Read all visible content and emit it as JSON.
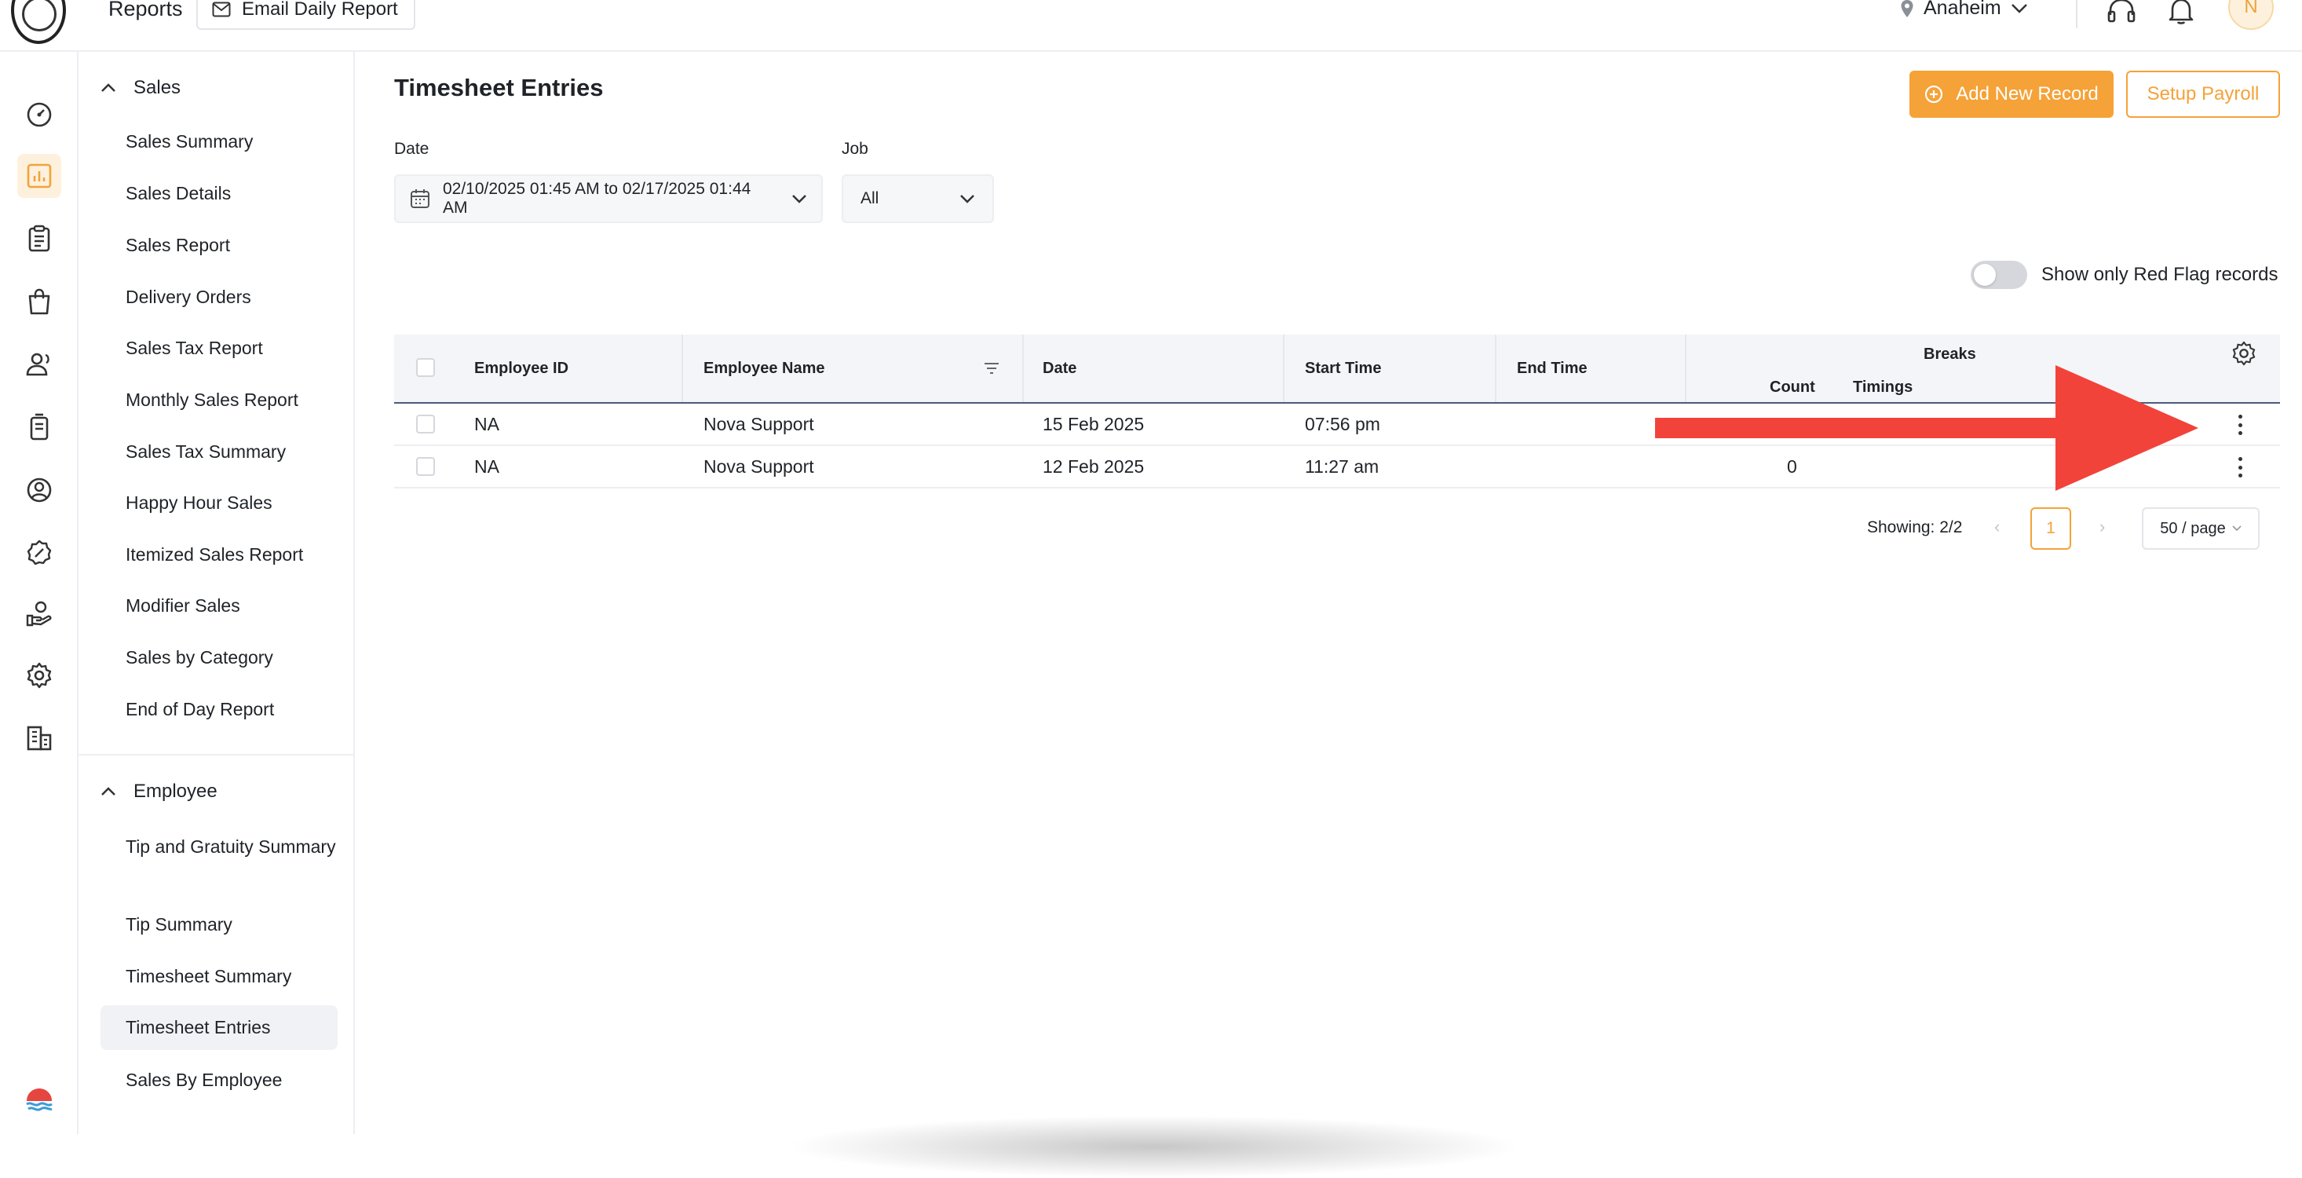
{
  "header": {
    "title": "Reports",
    "email_button": "Email Daily Report",
    "location": "Anaheim",
    "avatar_initial": "N"
  },
  "sidebar": {
    "sales_section": "Sales",
    "sales_items": [
      "Sales Summary",
      "Sales Details",
      "Sales Report",
      "Delivery Orders",
      "Sales Tax Report",
      "Monthly Sales Report",
      "Sales Tax Summary",
      "Happy Hour Sales",
      "Itemized Sales Report",
      "Modifier Sales",
      "Sales by Category",
      "End of Day Report"
    ],
    "employee_section": "Employee",
    "employee_items": [
      "Tip and Gratuity Summary",
      "Tip Summary",
      "Timesheet Summary",
      "Timesheet Entries",
      "Sales By Employee"
    ]
  },
  "main": {
    "title": "Timesheet Entries",
    "add_button": "Add New Record",
    "setup_button": "Setup Payroll",
    "date_label": "Date",
    "date_value": "02/10/2025 01:45 AM to 02/17/2025 01:44 AM",
    "job_label": "Job",
    "job_value": "All",
    "toggle_label": "Show only Red Flag records",
    "table": {
      "columns": {
        "employee_id": "Employee ID",
        "employee_name": "Employee Name",
        "date": "Date",
        "start_time": "Start Time",
        "end_time": "End Time",
        "breaks": "Breaks",
        "count": "Count",
        "timings": "Timings"
      },
      "rows": [
        {
          "employee_id": "NA",
          "employee_name": "Nova Support",
          "date": "15 Feb 2025",
          "start_time": "07:56 pm",
          "end_time": "",
          "count": ""
        },
        {
          "employee_id": "NA",
          "employee_name": "Nova Support",
          "date": "12 Feb 2025",
          "start_time": "11:27 am",
          "end_time": "",
          "count": "0"
        }
      ]
    },
    "pagination": {
      "showing": "Showing: 2/2",
      "current_page": "1",
      "page_size": "50 / page"
    }
  },
  "colors": {
    "accent": "#f5a238",
    "annotation_arrow": "#f2433a"
  }
}
